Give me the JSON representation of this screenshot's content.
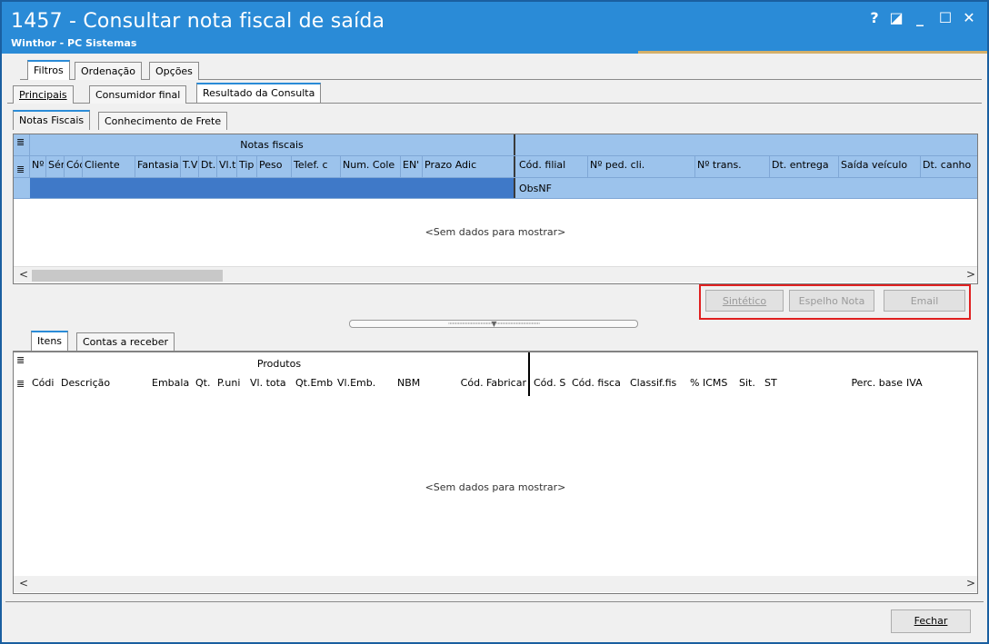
{
  "window": {
    "title": "1457 - Consultar nota fiscal de saída",
    "subtitle": "Winthor - PC Sistemas",
    "controls": {
      "help": "?",
      "restore": "◪",
      "minimize": "_",
      "maximize": "☐",
      "close": "✕"
    }
  },
  "top_tabs": [
    "Filtros",
    "Ordenação",
    "Opções"
  ],
  "sub_tabs": [
    "Principais",
    "Consumidor final",
    "Resultado da Consulta"
  ],
  "result_tabs": [
    "Notas Fiscais",
    "Conhecimento de Frete"
  ],
  "nf_grid": {
    "band_left": "Notas fiscais",
    "columns_left": [
      "Nº",
      "Sér",
      "Cód",
      "Cliente",
      "Fantasia",
      "T.V",
      "Dt.",
      "Vl.t",
      "Tip",
      "Peso",
      "Telef. c",
      "Num. Cole",
      "EN'",
      "Prazo Adic"
    ],
    "columns_right": [
      "Cód. filial",
      "Nº ped. cli.",
      "Nº trans.",
      "Dt. entrega",
      "Saída veículo",
      "Dt. canho"
    ],
    "sub_row": "ObsNF",
    "empty_text": "<Sem dados para mostrar>"
  },
  "actions": {
    "sintetico": "Sintético",
    "espelho": "Espelho Nota",
    "email": "Email"
  },
  "item_tabs": [
    "Itens",
    "Contas a receber"
  ],
  "items_grid": {
    "band_left": "Produtos",
    "columns_left": [
      "Códi",
      "Descrição",
      "Embala",
      "Qt.",
      "P.uni",
      "Vl. tota",
      "Qt.Emb",
      "Vl.Emb.",
      "NBM",
      "Cód. Fabricar"
    ],
    "columns_right": [
      "Cód. S",
      "Cód. fisca",
      "Classif.fis",
      "% ICMS",
      "Sit.",
      "ST",
      "Perc. base",
      "IVA"
    ],
    "empty_text": "<Sem dados para mostrar>"
  },
  "footer": {
    "close_button": "Fechar"
  },
  "colors": {
    "titlebar": "#2a8bd7",
    "header": "#9cc3ec",
    "highlight_border": "#e02020"
  }
}
